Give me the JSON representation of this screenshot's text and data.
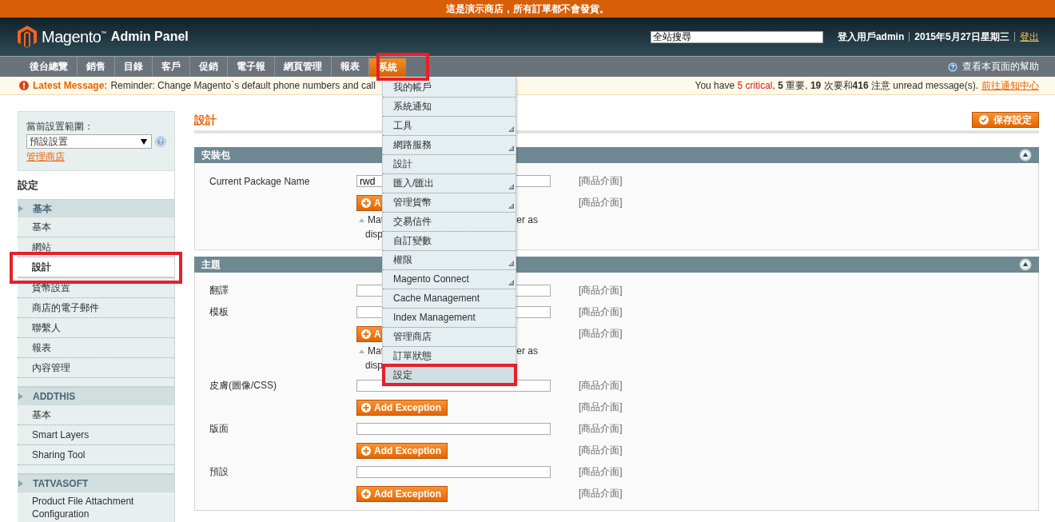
{
  "notice": "這是演示商店，所有訂單都不會發貨。",
  "header": {
    "logo_text": "Magento$^{™}$",
    "logo_sub": "Admin Panel",
    "search": {
      "placeholder": "全站搜尋"
    },
    "user": "登入用戶admin",
    "date": "2015年5月27日星期三",
    "logout": "登出"
  },
  "nav": {
    "items": [
      {
        "label": "後台總覽",
        "selected": false
      },
      {
        "label": "銷售",
        "selected": false
      },
      {
        "label": "目錄",
        "selected": false
      },
      {
        "label": "客戶",
        "selected": false
      },
      {
        "label": "促銷",
        "selected": false
      },
      {
        "label": "電子報",
        "selected": false
      },
      {
        "label": "網頁管理",
        "selected": false
      },
      {
        "label": "報表",
        "selected": false
      },
      {
        "label": "系統",
        "selected": true
      }
    ],
    "help": "查看本頁面的幫助"
  },
  "message_bar": {
    "title": "Latest Message:",
    "text": "Reminder: Change Magento`s default phone numbers and call",
    "summary": [
      {
        "kind": "plain",
        "text": "You have "
      },
      {
        "kind": "critical",
        "text": "5 critical"
      },
      {
        "kind": "plain",
        "text": ", "
      },
      {
        "kind": "bold",
        "text": "5"
      },
      {
        "kind": "plain",
        "text": " 重要, "
      },
      {
        "kind": "bold",
        "text": "19"
      },
      {
        "kind": "plain",
        "text": " 次要和"
      },
      {
        "kind": "bold",
        "text": "416"
      },
      {
        "kind": "plain",
        "text": " 注意 unread message(s)."
      }
    ],
    "link": "前往通知中心"
  },
  "system_menu": [
    {
      "label": "我的帳戶",
      "has_submenu": false,
      "selected": false
    },
    {
      "label": "系統通知",
      "has_submenu": false,
      "selected": false
    },
    {
      "label": "工具",
      "has_submenu": true,
      "selected": false
    },
    {
      "label": "網路服務",
      "has_submenu": true,
      "selected": false
    },
    {
      "label": "設計",
      "has_submenu": false,
      "selected": false
    },
    {
      "label": "匯入/匯出",
      "has_submenu": true,
      "selected": false
    },
    {
      "label": "管理貨幣",
      "has_submenu": true,
      "selected": false
    },
    {
      "label": "交易信件",
      "has_submenu": false,
      "selected": false
    },
    {
      "label": "自訂變數",
      "has_submenu": false,
      "selected": false
    },
    {
      "label": "權限",
      "has_submenu": true,
      "selected": false
    },
    {
      "label": "Magento Connect",
      "has_submenu": true,
      "selected": false
    },
    {
      "label": "Cache Management",
      "has_submenu": false,
      "selected": false
    },
    {
      "label": "Index Management",
      "has_submenu": false,
      "selected": false
    },
    {
      "label": "管理商店",
      "has_submenu": false,
      "selected": false
    },
    {
      "label": "訂單狀態",
      "has_submenu": false,
      "selected": false
    },
    {
      "label": "設定",
      "has_submenu": false,
      "selected": true
    }
  ],
  "scope": {
    "label": "當前設置範圍：",
    "value": "預設設置",
    "link": "管理商店"
  },
  "sidebar": {
    "title": "設定",
    "sections": [
      {
        "title": "基本",
        "items": [
          {
            "label": "基本",
            "selected": false
          },
          {
            "label": "網站",
            "selected": false
          },
          {
            "label": "設計",
            "selected": true
          },
          {
            "label": "貨幣設置",
            "selected": false
          },
          {
            "label": "商店的電子郵件",
            "selected": false
          },
          {
            "label": "聯繫人",
            "selected": false
          },
          {
            "label": "報表",
            "selected": false
          },
          {
            "label": "內容管理",
            "selected": false
          }
        ]
      },
      {
        "title": "ADDTHIS",
        "items": [
          {
            "label": "基本",
            "selected": false
          },
          {
            "label": "Smart Layers",
            "selected": false
          },
          {
            "label": "Sharing Tool",
            "selected": false
          }
        ]
      },
      {
        "title": "TATVASOFT",
        "items": [
          {
            "label": "Product File Attachment Configuration",
            "selected": false
          }
        ]
      }
    ]
  },
  "page_title": "設計",
  "save_button": "保存設定",
  "fieldsets": [
    {
      "title": "安裝包",
      "rows": [
        {
          "kind": "input",
          "label": "Current Package Name",
          "value": "rwd",
          "scope": "[商品介面]"
        },
        {
          "kind": "button",
          "label": "A",
          "scope": "[商品介面]"
        },
        {
          "kind": "hint",
          "left": "Mat",
          "right": "er as",
          "line2": "disp"
        }
      ]
    },
    {
      "title": "主題",
      "rows": [
        {
          "kind": "input",
          "label": "翻譯",
          "value": "",
          "scope": "[商品介面]"
        },
        {
          "kind": "input",
          "label": "模板",
          "value": "",
          "scope": "[商品介面]"
        },
        {
          "kind": "button",
          "label": "A",
          "scope": "[商品介面]"
        },
        {
          "kind": "hint",
          "left": "Mat",
          "right": "er as",
          "line2": "disp"
        },
        {
          "kind": "input",
          "label": "皮膚(圖像/CSS)",
          "value": "",
          "scope": "[商品介面]"
        },
        {
          "kind": "button",
          "label": "Add Exception",
          "scope": "[商品介面]"
        },
        {
          "kind": "input",
          "label": "版面",
          "value": "",
          "scope": "[商品介面]"
        },
        {
          "kind": "button",
          "label": "Add Exception",
          "scope": "[商品介面]"
        },
        {
          "kind": "input",
          "label": "預設",
          "value": "",
          "scope": "[商品介面]"
        },
        {
          "kind": "button",
          "label": "Add Exception",
          "scope": "[商品介面]"
        }
      ]
    }
  ]
}
